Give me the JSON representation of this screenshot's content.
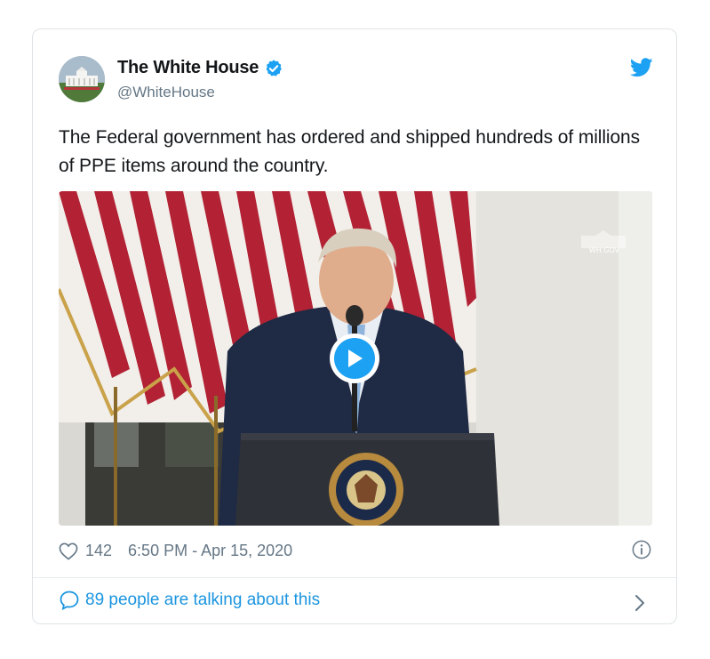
{
  "tweet": {
    "author_name": "The White House",
    "author_handle": "@WhiteHouse",
    "text": "The Federal government has ordered and shipped hundreds of millions of PPE items around the country.",
    "likes": "142",
    "timestamp": "6:50 PM - Apr 15, 2020",
    "talking": "89 people are talking about this"
  },
  "media": {
    "watermark_label": "WH.GOV",
    "seal_text": "PRESIDENT OF THE UNITED",
    "type": "video"
  },
  "colors": {
    "accent": "#1da1f2",
    "link": "#1b95e0",
    "muted": "#657786",
    "border": "#dfe3e6"
  },
  "icons": [
    "verified-badge-icon",
    "twitter-bird-icon",
    "play-icon",
    "heart-icon",
    "info-icon",
    "speech-bubble-icon",
    "chevron-right-icon"
  ]
}
